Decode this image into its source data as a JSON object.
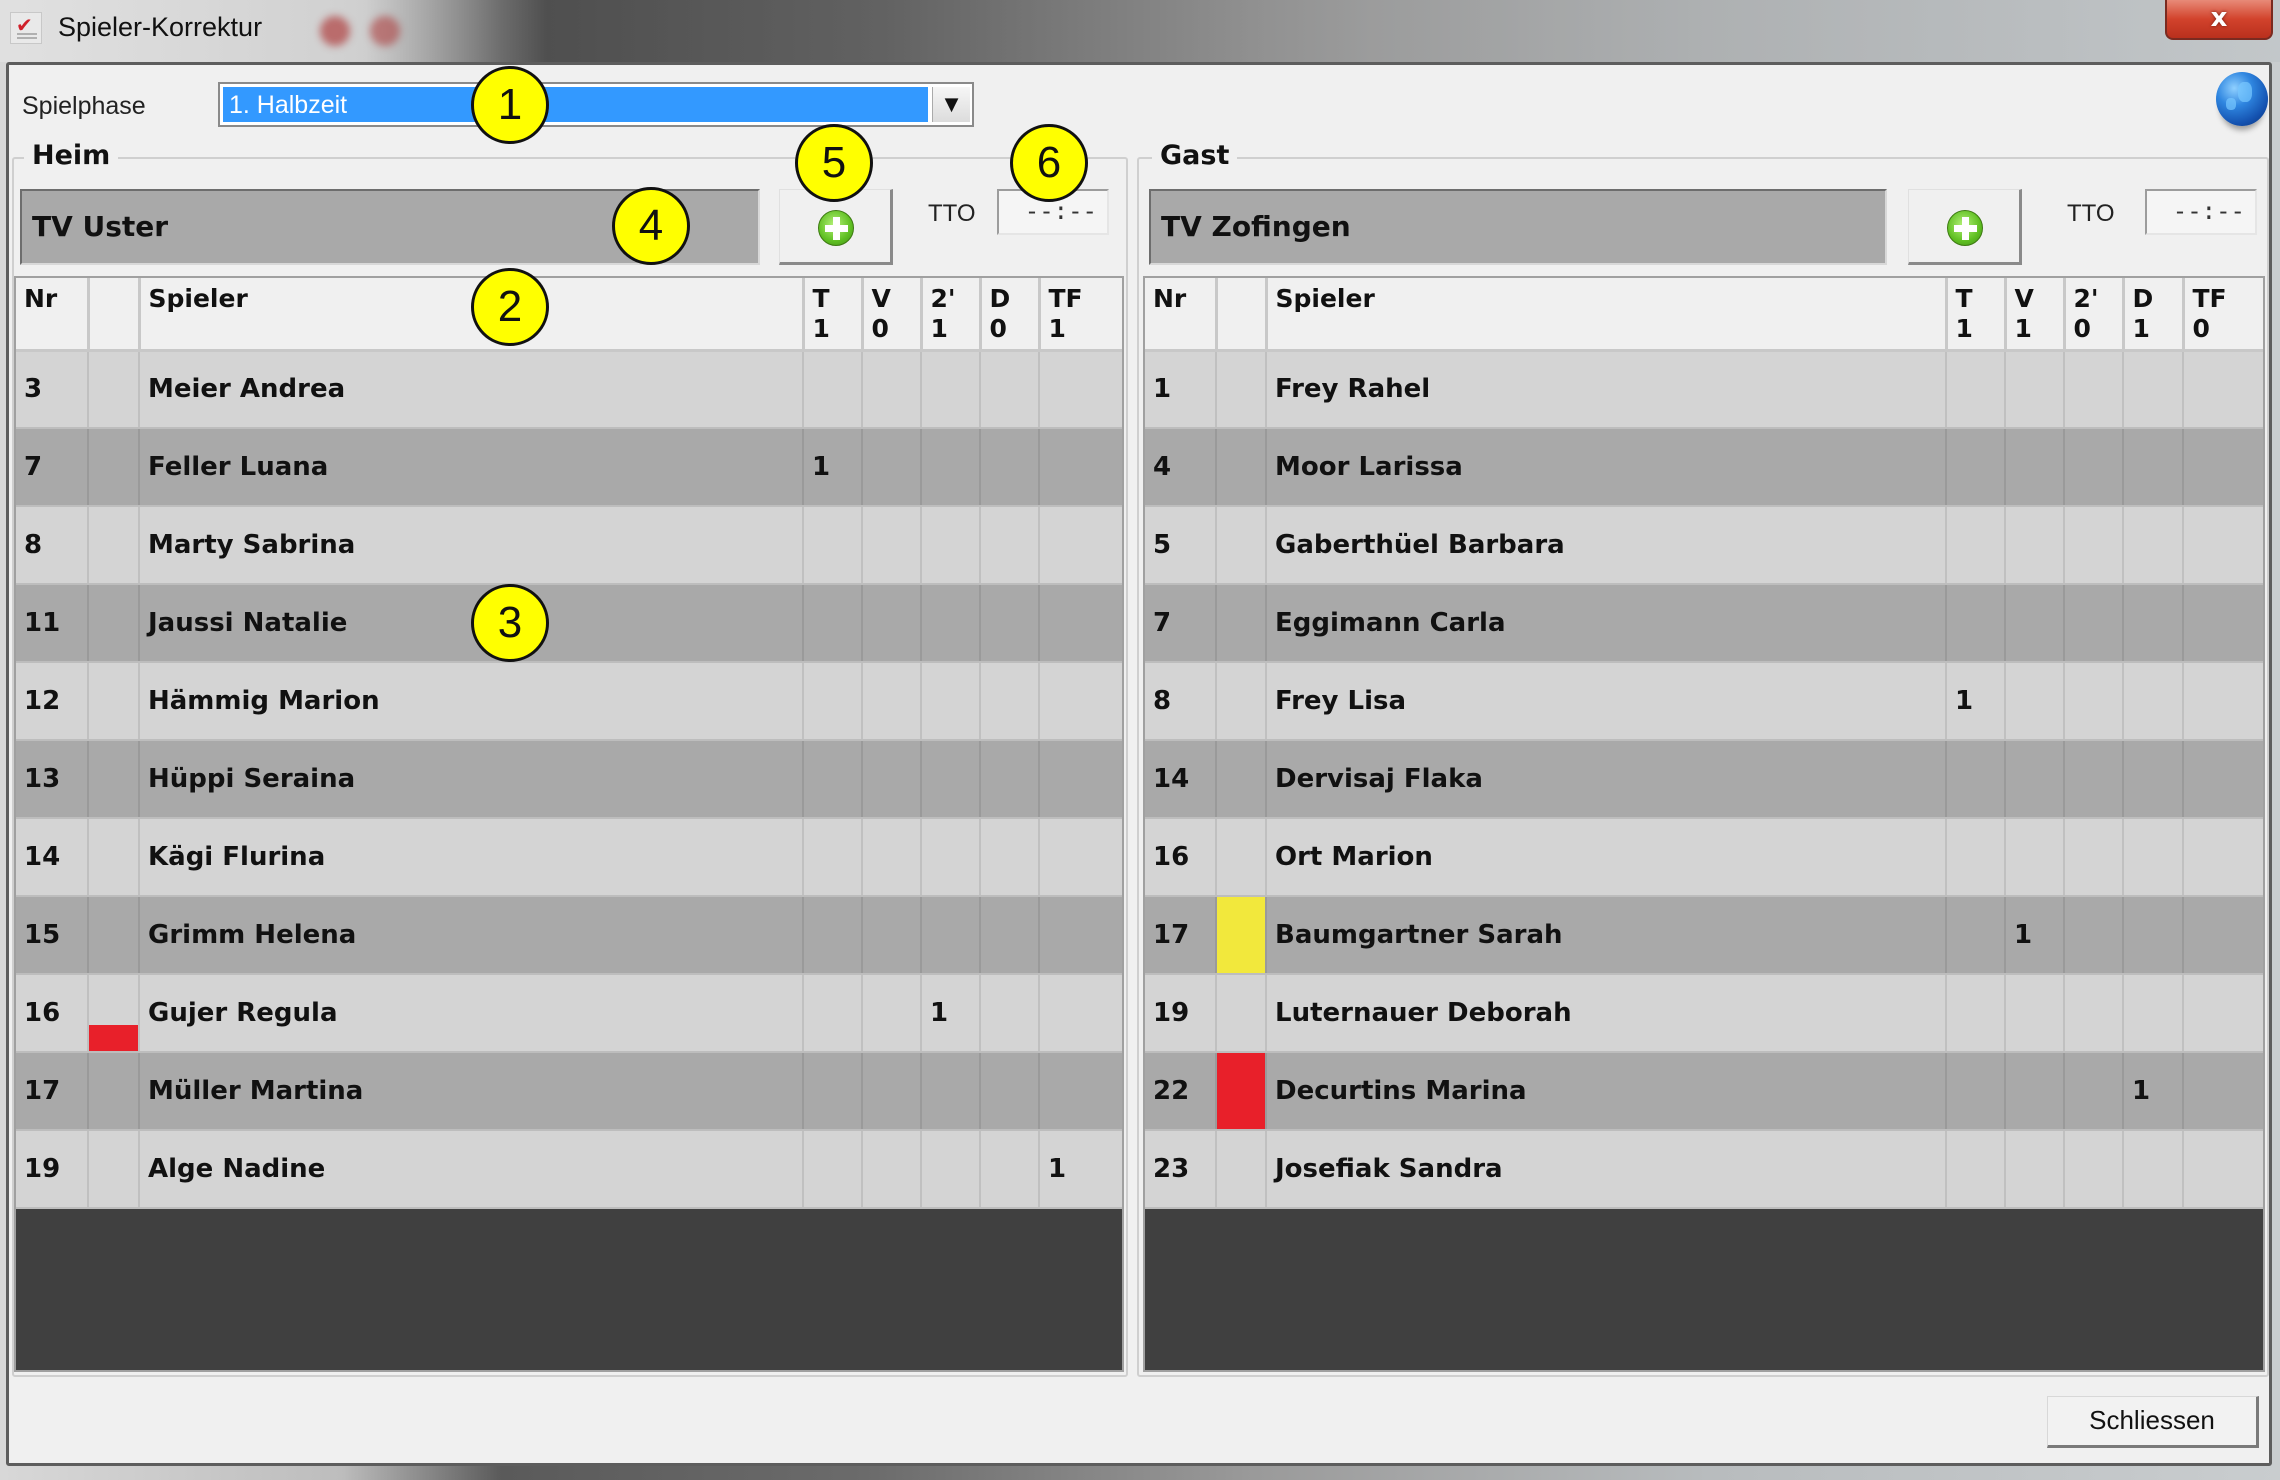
{
  "window": {
    "title": "Spieler-Korrektur",
    "close_glyph": "x"
  },
  "phase": {
    "label": "Spielphase",
    "selected": "1. Halbzeit",
    "arrow_glyph": "▼"
  },
  "columns": {
    "nr": "Nr",
    "card": "",
    "player": "Spieler",
    "stats": [
      "T",
      "V",
      "2'",
      "D",
      "TF"
    ]
  },
  "colors": {
    "selection": "#3399ff",
    "yellow_card": "#f2e83c",
    "red_card": "#e8202a",
    "callout": "#ffff00"
  },
  "home": {
    "group_label": "Heim",
    "team_name": "TV Uster",
    "tto_label": "TTO",
    "tto_value": "--:--",
    "stat_totals": [
      "1",
      "0",
      "1",
      "0",
      "1"
    ],
    "players": [
      {
        "nr": "3",
        "name": "Meier Andrea",
        "card": null,
        "stats": [
          "",
          "",
          "",
          "",
          ""
        ]
      },
      {
        "nr": "7",
        "name": "Feller Luana",
        "card": null,
        "stats": [
          "1",
          "",
          "",
          "",
          ""
        ]
      },
      {
        "nr": "8",
        "name": "Marty Sabrina",
        "card": null,
        "stats": [
          "",
          "",
          "",
          "",
          ""
        ]
      },
      {
        "nr": "11",
        "name": "Jaussi Natalie",
        "card": null,
        "stats": [
          "",
          "",
          "",
          "",
          ""
        ]
      },
      {
        "nr": "12",
        "name": "Hämmig Marion",
        "card": null,
        "stats": [
          "",
          "",
          "",
          "",
          ""
        ]
      },
      {
        "nr": "13",
        "name": "Hüppi Seraina",
        "card": null,
        "stats": [
          "",
          "",
          "",
          "",
          ""
        ]
      },
      {
        "nr": "14",
        "name": "Kägi Flurina",
        "card": null,
        "stats": [
          "",
          "",
          "",
          "",
          ""
        ]
      },
      {
        "nr": "15",
        "name": "Grimm Helena",
        "card": null,
        "stats": [
          "",
          "",
          "",
          "",
          ""
        ]
      },
      {
        "nr": "16",
        "name": "Gujer Regula",
        "card": "red-partial",
        "stats": [
          "",
          "",
          "1",
          "",
          ""
        ]
      },
      {
        "nr": "17",
        "name": "Müller Martina",
        "card": null,
        "stats": [
          "",
          "",
          "",
          "",
          ""
        ]
      },
      {
        "nr": "19",
        "name": "Alge Nadine",
        "card": null,
        "stats": [
          "",
          "",
          "",
          "",
          "1"
        ]
      }
    ]
  },
  "guest": {
    "group_label": "Gast",
    "team_name": "TV Zofingen",
    "tto_label": "TTO",
    "tto_value": "--:--",
    "stat_totals": [
      "1",
      "1",
      "0",
      "1",
      "0"
    ],
    "players": [
      {
        "nr": "1",
        "name": "Frey Rahel",
        "card": null,
        "stats": [
          "",
          "",
          "",
          "",
          ""
        ]
      },
      {
        "nr": "4",
        "name": "Moor Larissa",
        "card": null,
        "stats": [
          "",
          "",
          "",
          "",
          ""
        ]
      },
      {
        "nr": "5",
        "name": "Gaberthüel Barbara",
        "card": null,
        "stats": [
          "",
          "",
          "",
          "",
          ""
        ]
      },
      {
        "nr": "7",
        "name": "Eggimann Carla",
        "card": null,
        "stats": [
          "",
          "",
          "",
          "",
          ""
        ]
      },
      {
        "nr": "8",
        "name": "Frey Lisa",
        "card": null,
        "stats": [
          "1",
          "",
          "",
          "",
          ""
        ]
      },
      {
        "nr": "14",
        "name": "Dervisaj Flaka",
        "card": null,
        "stats": [
          "",
          "",
          "",
          "",
          ""
        ]
      },
      {
        "nr": "16",
        "name": "Ort Marion",
        "card": null,
        "stats": [
          "",
          "",
          "",
          "",
          ""
        ]
      },
      {
        "nr": "17",
        "name": "Baumgartner Sarah",
        "card": "yellow",
        "stats": [
          "",
          "1",
          "",
          "",
          ""
        ]
      },
      {
        "nr": "19",
        "name": "Luternauer Deborah",
        "card": null,
        "stats": [
          "",
          "",
          "",
          "",
          ""
        ]
      },
      {
        "nr": "22",
        "name": "Decurtins Marina",
        "card": "red",
        "stats": [
          "",
          "",
          "",
          "1",
          ""
        ]
      },
      {
        "nr": "23",
        "name": "Josefiak Sandra",
        "card": null,
        "stats": [
          "",
          "",
          "",
          "",
          ""
        ]
      }
    ]
  },
  "footer": {
    "close_label": "Schliessen"
  },
  "callouts": [
    "1",
    "2",
    "3",
    "4",
    "5",
    "6"
  ]
}
